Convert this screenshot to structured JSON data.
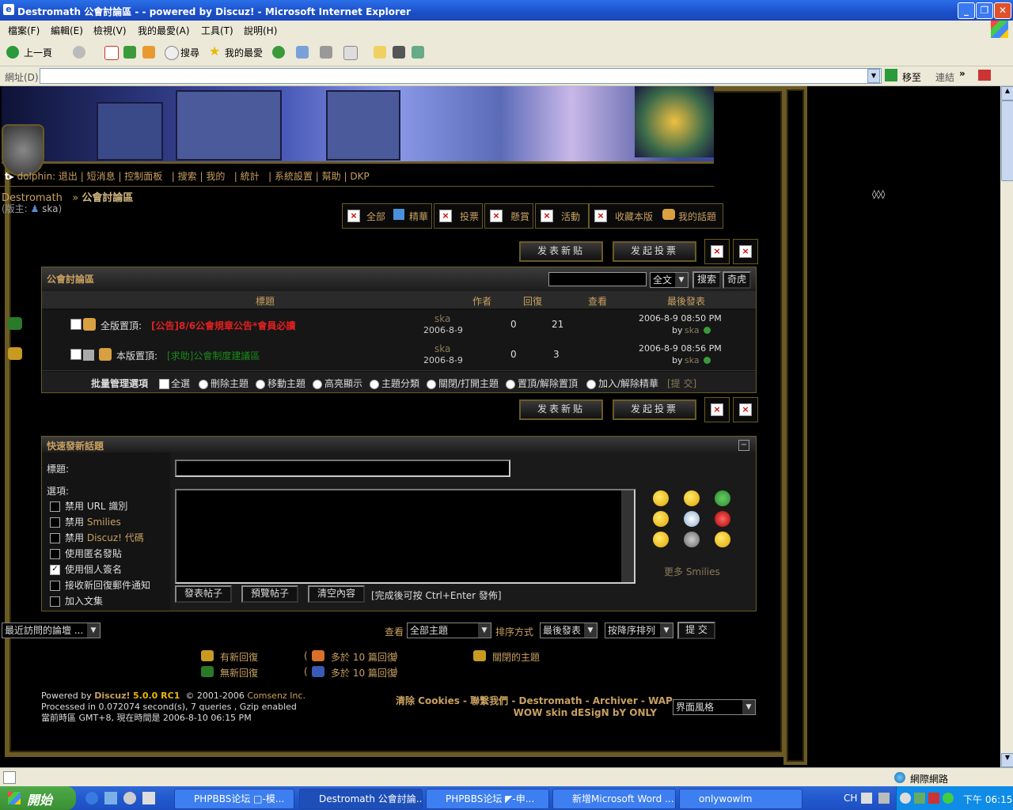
{
  "window": {
    "title": "Destromath 公會討論區 - - powered by Discuz! - Microsoft Internet Explorer"
  },
  "ie_menu": [
    "檔案(F)",
    "編輯(E)",
    "檢視(V)",
    "我的最愛(A)",
    "工具(T)",
    "說明(H)"
  ],
  "ie_toolbar": {
    "back": "上一頁",
    "search": "搜尋",
    "favorites": "我的最愛"
  },
  "address": {
    "label": "網址(D)",
    "go": "移至",
    "links": "連結"
  },
  "forum_nav": {
    "user": "dolphin",
    "links": [
      "退出",
      "短消息",
      "控制面板",
      "搜索",
      "我的",
      "統計",
      "系統設置",
      "幫助",
      "DKP"
    ]
  },
  "breadcrumb": {
    "site": "Destromath",
    "sep": "»",
    "forum": "公會討論區"
  },
  "moderator": {
    "label": "(版主:",
    "name": "ska",
    "close": ")"
  },
  "filters": [
    "全部",
    "精華",
    "投票",
    "懸賞",
    "活動",
    "收藏本版",
    "我的話題"
  ],
  "buttons": {
    "new_post": "发表新贴",
    "new_poll": "发起投票"
  },
  "forum": {
    "title": "公會討論區",
    "search_scope": "全文",
    "search_btn": "搜索",
    "qihu_btn": "奇虎",
    "columns": [
      "標題",
      "作者",
      "回復",
      "查看",
      "最後發表"
    ],
    "threads": [
      {
        "type": "全版置頂:",
        "subject": "[公告]8/6公會規章公告*會員必讀",
        "author": "ska",
        "date": "2006-8-9",
        "replies": "0",
        "views": "21",
        "last_time": "2006-8-9 08:50 PM",
        "last_by": "by",
        "last_user": "ska"
      },
      {
        "type": "本版置頂:",
        "subject": "[求助]公會制度建議區",
        "author": "ska",
        "date": "2006-8-9",
        "replies": "0",
        "views": "3",
        "last_time": "2006-8-9 08:56 PM",
        "last_by": "by",
        "last_user": "ska"
      }
    ],
    "batch": {
      "label": "批量管理選項",
      "options": [
        "全選",
        "刪除主題",
        "移動主題",
        "高亮顯示",
        "主題分類",
        "關閉/打開主題",
        "置頂/解除置頂",
        "加入/解除精華"
      ],
      "submit": "[提 交]"
    }
  },
  "quickpost": {
    "title": "快速發新話題",
    "subject_label": "標題:",
    "options_label": "選項:",
    "options": [
      {
        "pre": "禁用 URL 識別",
        "link": "",
        "checked": false
      },
      {
        "pre": "禁用 ",
        "link": "Smilies",
        "checked": false
      },
      {
        "pre": "禁用 ",
        "link": "Discuz! 代碼",
        "checked": false
      },
      {
        "pre": "使用匿名發貼",
        "link": "",
        "checked": false
      },
      {
        "pre": "使用個人簽名",
        "link": "",
        "checked": true
      },
      {
        "pre": "接收新回復郵件通知",
        "link": "",
        "checked": false
      },
      {
        "pre": "加入文集",
        "link": "",
        "checked": false
      }
    ],
    "more_smilies": "更多 Smilies",
    "submit": "發表帖子",
    "preview": "預覽帖子",
    "clear": "清空內容",
    "hint": "[完成後可按 Ctrl+Enter 發佈]"
  },
  "bottom": {
    "recent": "最近訪問的論壇 ...",
    "view_label": "查看",
    "view_value": "全部主題",
    "sort_label": "排序方式",
    "sort_value": "最後發表",
    "order_value": "按降序排列",
    "submit": "提 交"
  },
  "legend": {
    "new_reply": "有新回復",
    "no_new": "無新回復",
    "hot_new": "多於 10 篇回復",
    "hot_no": "多於 10 篇回復",
    "closed": "關閉的主題",
    "lp": "(",
    "rp": ")"
  },
  "footer": {
    "powered": "Powered by",
    "discuz": "Discuz!",
    "version": "5.0.0 RC1",
    "copyright": "© 2001-2006",
    "comsenz": "Comsenz Inc.",
    "processed": "Processed in 0.072074 second(s), 7 queries , Gzip enabled",
    "timezone": "當前時區 GMT+8, 現在時間是 2006-8-10 06:15 PM",
    "links_line1": "清除 Cookies - 聯繫我們 - Destromath - Archiver - WAP",
    "links_line2": "WOW skin dESigN bY ONLY",
    "style_select": "界面風格"
  },
  "side_text": "◊◊◊",
  "status": {
    "zone": "網際網路"
  },
  "taskbar": {
    "start": "開始",
    "tasks": [
      "PHPBBS论坛 □-模...",
      "Destromath 公會討論...",
      "PHPBBS论坛 ◤-申...",
      "新增Microsoft Word ...",
      "onlywowlm"
    ],
    "lang": "CH",
    "time": "下午 06:15"
  }
}
